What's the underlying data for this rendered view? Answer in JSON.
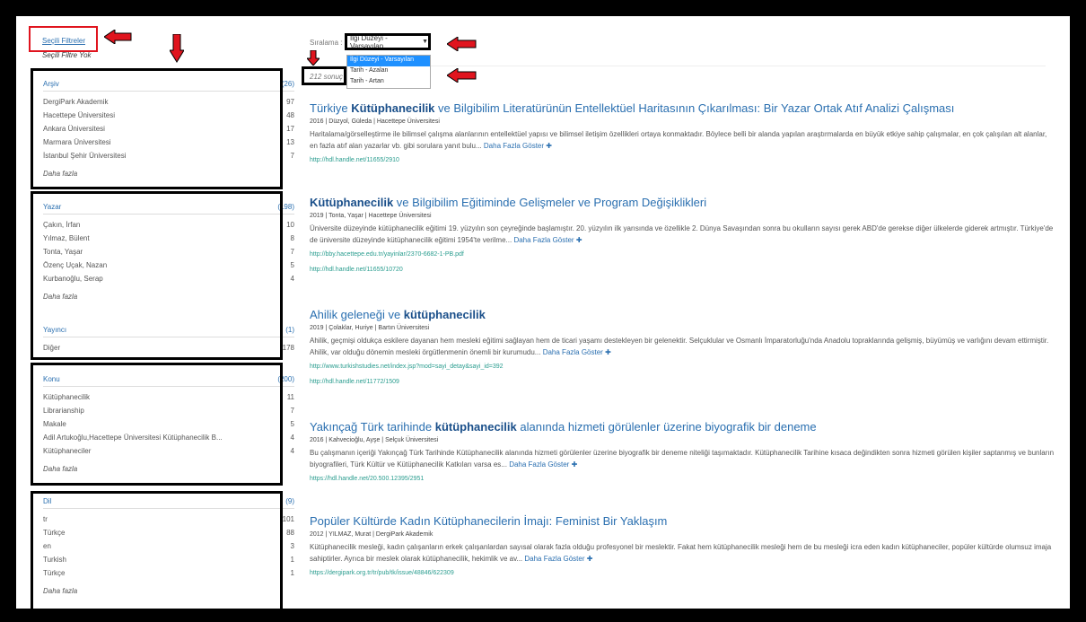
{
  "filters": {
    "title": "Seçili Filtreler",
    "none": "Seçili Filtre Yok"
  },
  "facets": [
    {
      "title": "Arşiv",
      "count": "(26)",
      "items": [
        {
          "label": "DergiPark Akademik",
          "n": "97"
        },
        {
          "label": "Hacettepe Üniversitesi",
          "n": "48"
        },
        {
          "label": "Ankara Üniversitesi",
          "n": "17"
        },
        {
          "label": "Marmara Üniversitesi",
          "n": "13"
        },
        {
          "label": "İstanbul Şehir Üniversitesi",
          "n": "7"
        }
      ],
      "more": "Daha fazla"
    },
    {
      "title": "Yazar",
      "count": "(198)",
      "items": [
        {
          "label": "Çakın, İrfan",
          "n": "10"
        },
        {
          "label": "Yılmaz, Bülent",
          "n": "8"
        },
        {
          "label": "Tonta, Yaşar",
          "n": "7"
        },
        {
          "label": "Özenç Uçak, Nazan",
          "n": "5"
        },
        {
          "label": "Kurbanoğlu, Serap",
          "n": "4"
        }
      ],
      "more": "Daha fazla"
    },
    {
      "title": "Yayıncı",
      "count": "(1)",
      "items": [
        {
          "label": "Diğer",
          "n": "178"
        }
      ],
      "more": ""
    },
    {
      "title": "Konu",
      "count": "(200)",
      "items": [
        {
          "label": "Kütüphanecilik",
          "n": "11"
        },
        {
          "label": "Librarianship",
          "n": "7"
        },
        {
          "label": "Makale",
          "n": "5"
        },
        {
          "label": "Adil Artukoğlu,Hacettepe Üniversitesi Kütüphanecilik B...",
          "n": "4"
        },
        {
          "label": "Kütüphaneciler",
          "n": "4"
        }
      ],
      "more": "Daha fazla"
    },
    {
      "title": "Dil",
      "count": "(9)",
      "items": [
        {
          "label": "tr",
          "n": "101"
        },
        {
          "label": "Türkçe",
          "n": "88"
        },
        {
          "label": "en",
          "n": "3"
        },
        {
          "label": "Turkish",
          "n": "1"
        },
        {
          "label": "Türkçe",
          "n": "1"
        }
      ],
      "more": "Daha fazla"
    }
  ],
  "sort": {
    "label": "Sıralama :",
    "selected": "İlgi Düzeyi - Varsayılan",
    "options": [
      "İlgi Düzeyi - Varsayılan",
      "Tarih - Azalan",
      "Tarih - Artan"
    ]
  },
  "count": "212 sonuç",
  "more_label": "Daha Fazla Göster",
  "results": [
    {
      "title_pre": "Türkiye ",
      "title_b": "Kütüphanecilik",
      "title_post": " ve Bilgibilim Literatürünün Entellektüel Haritasının Çıkarılması: Bir Yazar Ortak Atıf Analizi Çalışması",
      "meta": "2016 | Düzyol, Güleda | Hacettepe Üniversitesi",
      "abstract": "Haritalama/görselleştirme ile bilimsel çalışma alanlarının entellektüel yapısı ve bilimsel iletişim özellikleri ortaya konmaktadır. Böylece belli bir alanda yapılan araştırmalarda en büyük etkiye sahip çalışmalar, en çok çalışılan alt alanlar, en fazla atıf alan yazarlar vb. gibi sorulara yanıt bulu...",
      "links": [
        "http://hdl.handle.net/11655/2910"
      ]
    },
    {
      "title_pre": "",
      "title_b": "Kütüphanecilik",
      "title_post": " ve Bilgibilim Eğitiminde Gelişmeler ve Program Değişiklikleri",
      "meta": "2019 | Tonta, Yaşar | Hacettepe Üniversitesi",
      "abstract": "Üniversite düzeyinde kütüphanecilik eğitimi 19. yüzyılın son çeyreğinde başlamıştır. 20. yüzyılın ilk yarısında ve özellikle 2. Dünya Savaşından sonra bu okulların sayısı gerek ABD'de gerekse diğer ülkelerde giderek artmıştır. Türkiye'de de üniversite düzeyinde kütüphanecilik eğitimi 1954'te verilme...",
      "links": [
        "http://bby.hacettepe.edu.tr/yayinlar/2370-6682-1-PB.pdf",
        "http://hdl.handle.net/11655/10720"
      ]
    },
    {
      "title_pre": "Ahilik geleneği ve ",
      "title_b": "kütüphanecilik",
      "title_post": "",
      "meta": "2019 | Çolaklar, Huriye | Bartın Üniversitesi",
      "abstract": "Ahilik, geçmişi oldukça eskilere dayanan hem mesleki eğitimi sağlayan hem de ticari yaşamı destekleyen bir gelenektir. Selçuklular ve Osmanlı İmparatorluğu'nda Anadolu topraklarında gelişmiş, büyümüş ve varlığını devam ettirmiştir. Ahilik, var olduğu dönemin mesleki örgütlenmenin önemli bir kurumudu...",
      "links": [
        "http://www.turkishstudies.net/index.jsp?mod=sayi_detay&sayi_id=392",
        "http://hdl.handle.net/11772/1509"
      ]
    },
    {
      "title_pre": "Yakınçağ Türk tarihinde ",
      "title_b": "kütüphanecilik",
      "title_post": " alanında hizmeti görülenler üzerine biyografik bir deneme",
      "meta": "2016 | Kahvecioğlu, Ayşe | Selçuk Üniversitesi",
      "abstract": "Bu çalışmanın içeriği Yakınçağ Türk Tarihinde Kütüphanecilik alanında hizmeti görülenler üzerine biyografik bir deneme niteliği taşımaktadır. Kütüphanecilik Tarihine kısaca değindikten sonra hizmeti görülen kişiler saptanmış ve bunların biyografileri, Türk Kültür ve Kütüphanecilik Katkıları varsa es...",
      "links": [
        "https://hdl.handle.net/20.500.12395/2951"
      ]
    },
    {
      "title_pre": "Popüler Kültürde Kadın Kütüphanecilerin İmajı: Feminist Bir Yaklaşım",
      "title_b": "",
      "title_post": "",
      "meta": "2012 | YILMAZ, Murat | DergiPark Akademik",
      "abstract": "Kütüphanecilik mesleği, kadın çalışanların erkek çalışanlardan sayısal olarak fazla olduğu profesyonel bir meslektir. Fakat hem kütüphanecilik mesleği hem de bu mesleği icra eden kadın kütüphaneciler, popüler kültürde olumsuz imaja sahiptirler. Ayrıca bir meslek olarak kütüphanecilik, hekimlik ve av...",
      "links": [
        "https://dergipark.org.tr/tr/pub/tk/issue/48846/622309"
      ]
    }
  ]
}
